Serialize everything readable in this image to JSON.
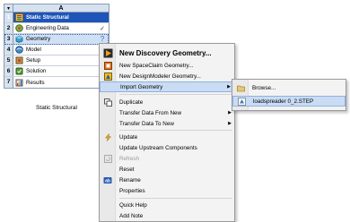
{
  "system": {
    "column_letter": "A",
    "caption": "Static Structural",
    "rows": [
      {
        "num": "1",
        "label": "Static Structural",
        "status": ""
      },
      {
        "num": "2",
        "label": "Engineering Data",
        "status": "✓"
      },
      {
        "num": "3",
        "label": "Geometry",
        "status": "?"
      },
      {
        "num": "4",
        "label": "Model",
        "status": "?"
      },
      {
        "num": "5",
        "label": "Setup",
        "status": "?"
      },
      {
        "num": "6",
        "label": "Solution",
        "status": "?"
      },
      {
        "num": "7",
        "label": "Results",
        "status": "?"
      }
    ]
  },
  "context_menu": {
    "items": [
      {
        "label": "New Discovery Geometry...",
        "icon": "discovery-icon"
      },
      {
        "label": "New SpaceClaim Geometry...",
        "icon": "spaceclaim-icon"
      },
      {
        "label": "New DesignModeler Geometry...",
        "icon": "designmodeler-icon"
      },
      {
        "label": "Import Geometry",
        "icon": ""
      },
      {
        "label": "Duplicate",
        "icon": "duplicate-icon"
      },
      {
        "label": "Transfer Data From New",
        "icon": ""
      },
      {
        "label": "Transfer Data To New",
        "icon": ""
      },
      {
        "label": "Update",
        "icon": "update-icon"
      },
      {
        "label": "Update Upstream Components",
        "icon": ""
      },
      {
        "label": "Refresh",
        "icon": "refresh-icon"
      },
      {
        "label": "Reset",
        "icon": ""
      },
      {
        "label": "Rename",
        "icon": "rename-icon"
      },
      {
        "label": "Properties",
        "icon": ""
      },
      {
        "label": "Quick Help",
        "icon": ""
      },
      {
        "label": "Add Note",
        "icon": ""
      }
    ]
  },
  "submenu": {
    "items": [
      {
        "label": "Browse...",
        "icon": "browse-icon"
      },
      {
        "label": "loadspreader 0_2.STEP",
        "icon": "step-file-icon"
      }
    ]
  },
  "colors": {
    "title_row": "#1f54b8",
    "selected_row": "#cfdff5",
    "menu_highlight": "#c9dcf4",
    "status_blue": "#3b6fb6"
  }
}
